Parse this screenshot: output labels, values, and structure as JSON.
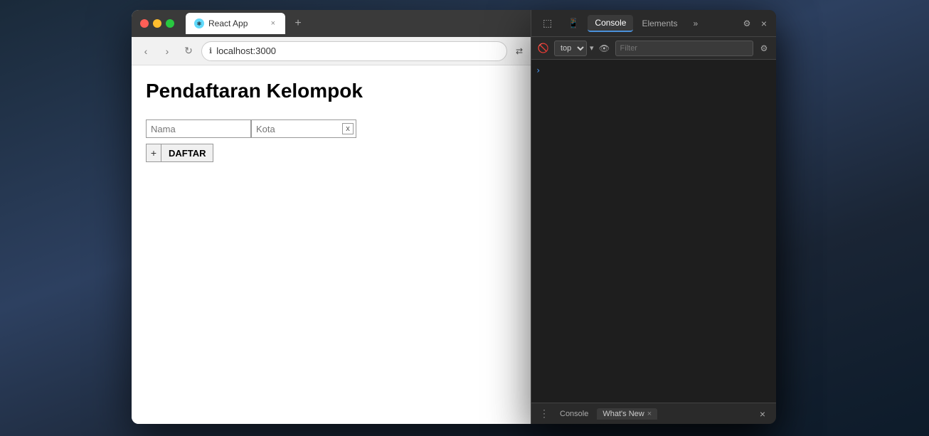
{
  "browser": {
    "tab": {
      "title": "React App",
      "favicon": "⚛",
      "close_label": "×"
    },
    "new_tab_label": "+",
    "nav": {
      "back_label": "‹",
      "forward_label": "›",
      "reload_label": "↻",
      "url": "localhost:3000",
      "lock_icon": "🔒"
    },
    "toolbar_icons": [
      "⇄",
      "☆",
      "🧩",
      "🛡",
      "⚙",
      "▽",
      "🎯",
      "🖼",
      "⚫",
      "↩",
      "❤",
      "🔄",
      "📧",
      "🐧",
      "⋮"
    ]
  },
  "page": {
    "title": "Pendaftaran Kelompok",
    "nama_placeholder": "Nama",
    "kota_placeholder": "Kota",
    "kota_clear_label": "x",
    "add_member_label": "+",
    "submit_label": "DAFTAR"
  },
  "devtools": {
    "tabs": [
      "Console",
      "Elements"
    ],
    "more_tabs_label": "»",
    "settings_label": "⚙",
    "close_label": "×",
    "toolbar": {
      "inspect_label": "⬚",
      "device_label": "📱",
      "top_label": "top",
      "dropdown_label": "▾",
      "eye_label": "👁",
      "filter_placeholder": "Filter",
      "settings_label": "⚙"
    },
    "body": {
      "prompt": "›"
    },
    "footer": {
      "menu_label": "⋮",
      "tab_label": "What's New",
      "tab_close_label": "×",
      "console_label": "Console",
      "close_label": "×"
    }
  }
}
